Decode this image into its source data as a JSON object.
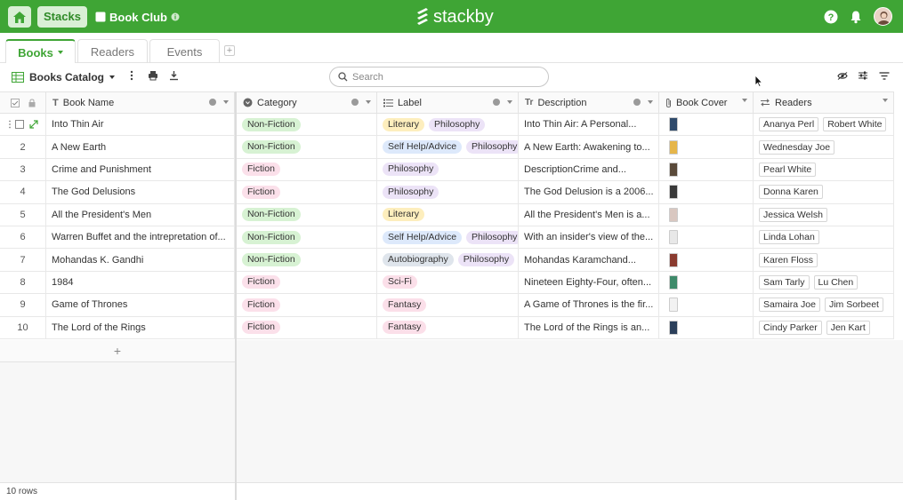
{
  "topbar": {
    "stacks_label": "Stacks",
    "base_title": "Book Club",
    "logo_text": "stackby",
    "brand_color": "#3fa535"
  },
  "tabs": [
    {
      "label": "Books",
      "active": true
    },
    {
      "label": "Readers",
      "active": false
    },
    {
      "label": "Events",
      "active": false
    }
  ],
  "toolbar": {
    "view_name": "Books Catalog",
    "search_placeholder": "Search"
  },
  "columns": [
    {
      "label": "Book Name",
      "icon": "text-icon"
    },
    {
      "label": "Category",
      "icon": "single-select-icon"
    },
    {
      "label": "Label",
      "icon": "multi-select-icon"
    },
    {
      "label": "Description",
      "icon": "long-text-icon"
    },
    {
      "label": "Book Cover",
      "icon": "attachment-icon"
    },
    {
      "label": "Readers",
      "icon": "link-icon"
    }
  ],
  "rows": [
    {
      "num": "1",
      "name": "Into Thin Air",
      "category": "Non-Fiction",
      "labels": [
        "Literary",
        "Philosophy"
      ],
      "description": "Into Thin Air: A Personal...",
      "cover_color": "#2f4a6b",
      "readers": [
        "Ananya Perl",
        "Robert White"
      ]
    },
    {
      "num": "2",
      "name": "A New Earth",
      "category": "Non-Fiction",
      "labels": [
        "Self Help/Advice",
        "Philosophy"
      ],
      "description": "A New Earth: Awakening to...",
      "cover_color": "#e6b64a",
      "readers": [
        "Wednesday Joe"
      ]
    },
    {
      "num": "3",
      "name": "Crime and Punishment",
      "category": "Fiction",
      "labels": [
        "Philosophy"
      ],
      "description": "DescriptionCrime and...",
      "cover_color": "#5a4a3a",
      "readers": [
        "Pearl White"
      ]
    },
    {
      "num": "4",
      "name": "The God Delusions",
      "category": "Fiction",
      "labels": [
        "Philosophy"
      ],
      "description": "The God Delusion is a 2006...",
      "cover_color": "#3a3a3a",
      "readers": [
        "Donna Karen"
      ]
    },
    {
      "num": "5",
      "name": "All the President's Men",
      "category": "Non-Fiction",
      "labels": [
        "Literary"
      ],
      "description": "All the President's Men is a...",
      "cover_color": "#d9c7c0",
      "readers": [
        "Jessica Welsh"
      ]
    },
    {
      "num": "6",
      "name": "Warren Buffet and the intrepretation of...",
      "category": "Non-Fiction",
      "labels": [
        "Self Help/Advice",
        "Philosophy"
      ],
      "description": "With an insider's view of the...",
      "cover_color": "#e8e8e8",
      "readers": [
        "Linda Lohan"
      ]
    },
    {
      "num": "7",
      "name": "Mohandas K. Gandhi",
      "category": "Non-Fiction",
      "labels": [
        "Autobiography",
        "Philosophy"
      ],
      "description": "Mohandas Karamchand...",
      "cover_color": "#8a3b2f",
      "readers": [
        "Karen Floss"
      ]
    },
    {
      "num": "8",
      "name": "1984",
      "category": "Fiction",
      "labels": [
        "Sci-Fi"
      ],
      "description": "Nineteen Eighty-Four, often...",
      "cover_color": "#3e8a6a",
      "readers": [
        "Sam Tarly",
        "Lu Chen"
      ]
    },
    {
      "num": "9",
      "name": "Game of Thrones",
      "category": "Fiction",
      "labels": [
        "Fantasy"
      ],
      "description": "A Game of Thrones is the fir...",
      "cover_color": "#f2f2f2",
      "readers": [
        "Samaira Joe",
        "Jim Sorbeet"
      ]
    },
    {
      "num": "10",
      "name": "The Lord of the Rings",
      "category": "Fiction",
      "labels": [
        "Fantasy"
      ],
      "description": "The Lord of the Rings is an...",
      "cover_color": "#2b3f5a",
      "readers": [
        "Cindy Parker",
        "Jen Kart"
      ]
    }
  ],
  "category_colors": {
    "Non-Fiction": "#d7f2d3",
    "Fiction": "#fbe0ea"
  },
  "label_colors": {
    "Literary": "#fdeebd",
    "Philosophy": "#ece3f7",
    "Self Help/Advice": "#dde9fb",
    "Autobiography": "#dfe5ec",
    "Sci-Fi": "#fbdfe9",
    "Fantasy": "#fbdfe9"
  },
  "footer": {
    "row_count": "10 rows"
  }
}
